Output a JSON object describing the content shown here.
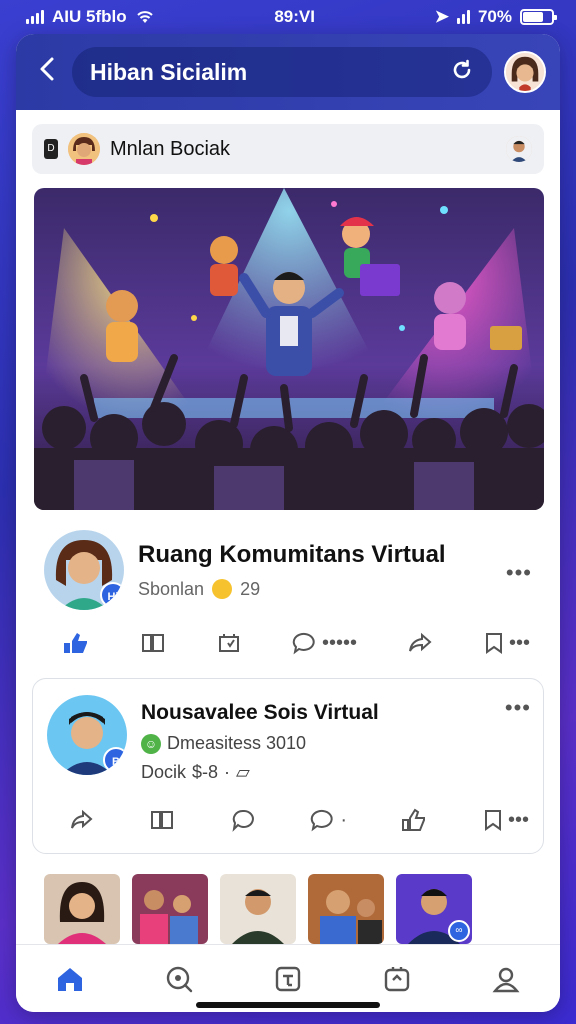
{
  "status": {
    "left_text": "AIU 5fblo",
    "time": "89:VI",
    "battery_text": "70%",
    "battery_level": 0.7
  },
  "header": {
    "title": "Hiban Sicialim"
  },
  "group": {
    "name": "Mnlan Bociak",
    "badge": "D"
  },
  "post1": {
    "title": "Ruang Komumitans Virtual",
    "subtitle": "Sbonlan",
    "count": "29",
    "more": "•••",
    "badge": "Hi",
    "action_more": "•••••"
  },
  "post2": {
    "title": "Nousavalee Sois Virtual",
    "line1": "Dmeasitess 3010",
    "line2": "Docik",
    "line2_value": "$-8",
    "more": "•••",
    "badge": "B"
  },
  "colors": {
    "accent": "#2f64e0",
    "header": "#2b3aa5",
    "background": "#3a3fd1"
  },
  "icons": {
    "back": "chevron-left-icon",
    "refresh": "refresh-icon",
    "home": "home-icon",
    "search": "search-icon",
    "add": "add-icon",
    "notifications": "notification-icon",
    "profile": "profile-icon"
  }
}
